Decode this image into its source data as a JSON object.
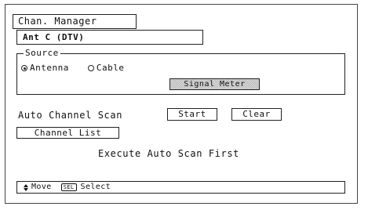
{
  "menu": {
    "title": "Chan. Manager",
    "input_name": "Ant C (DTV)"
  },
  "source": {
    "legend": "Source",
    "options": [
      {
        "label": "Antenna",
        "selected": true
      },
      {
        "label": "Cable",
        "selected": false
      }
    ],
    "signal_meter_label": "Signal Meter"
  },
  "scan": {
    "label": "Auto Channel Scan",
    "start_label": "Start",
    "clear_label": "Clear"
  },
  "channel_list_label": "Channel List",
  "message": "Execute Auto Scan First",
  "help": {
    "move_label": "Move",
    "sel_key": "SEL",
    "select_label": "Select"
  }
}
